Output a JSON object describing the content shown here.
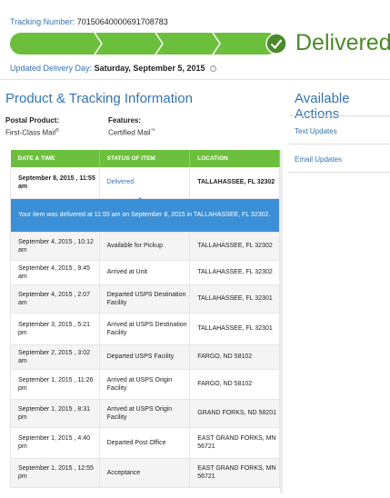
{
  "tracking": {
    "label": "Tracking Number:",
    "number": "70150640000691708783"
  },
  "progress": {
    "status": "Delivered",
    "fraction": 1.0,
    "color": "#6cbf3c"
  },
  "updated": {
    "label": "Updated Delivery Day:",
    "value": "Saturday, September 5, 2015",
    "info_icon": "?"
  },
  "section": {
    "title": "Product & Tracking Information"
  },
  "product": {
    "label": "Postal Product:",
    "value": "First-Class Mail",
    "value_mark": "®"
  },
  "features": {
    "label": "Features:",
    "value": "Certified Mail",
    "value_mark": "™"
  },
  "actions": {
    "title": "Available Actions",
    "items": [
      {
        "label": "Text Updates"
      },
      {
        "label": "Email Updates"
      }
    ]
  },
  "table": {
    "headers": [
      "DATE & TIME",
      "STATUS OF ITEM",
      "LOCATION"
    ],
    "first_row": {
      "date": "September 8, 2015 , 11:55 am",
      "status": "Delivered",
      "location": "TALLAHASSEE, FL 32302"
    },
    "banner": "Your item was delivered at 11:55 am on September 8, 2015 in TALLAHASSEE, FL 32302.",
    "rows": [
      {
        "date": "September 4, 2015 , 10:12 am",
        "status": "Available for Pickup",
        "location": "TALLAHASSEE, FL 32302"
      },
      {
        "date": "September 4, 2015 , 9:45 am",
        "status": "Arrived at Unit",
        "location": "TALLAHASSEE, FL 32302"
      },
      {
        "date": "September 4, 2015 , 2:07 am",
        "status": "Departed USPS Destination Facility",
        "location": "TALLAHASSEE, FL 32301"
      },
      {
        "date": "September 3, 2015 , 5:21 pm",
        "status": "Arrived at USPS Destination Facility",
        "location": "TALLAHASSEE, FL 32301"
      },
      {
        "date": "September 2, 2015 , 3:02 am",
        "status": "Departed USPS Facility",
        "location": "FARGO, ND 58102"
      },
      {
        "date": "September 1, 2015 , 11:26 pm",
        "status": "Arrived at USPS Origin Facility",
        "location": "FARGO, ND 58102"
      },
      {
        "date": "September 1, 2015 , 8:31 pm",
        "status": "Arrived at USPS Origin Facility",
        "location": "GRAND FORKS, ND 58201"
      },
      {
        "date": "September 1, 2015 , 4:40 pm",
        "status": "Departed Post Office",
        "location": "EAST GRAND FORKS, MN 56721"
      },
      {
        "date": "September 1, 2015 , 12:55 pm",
        "status": "Acceptance",
        "location": "EAST GRAND FORKS, MN 56721"
      }
    ]
  }
}
